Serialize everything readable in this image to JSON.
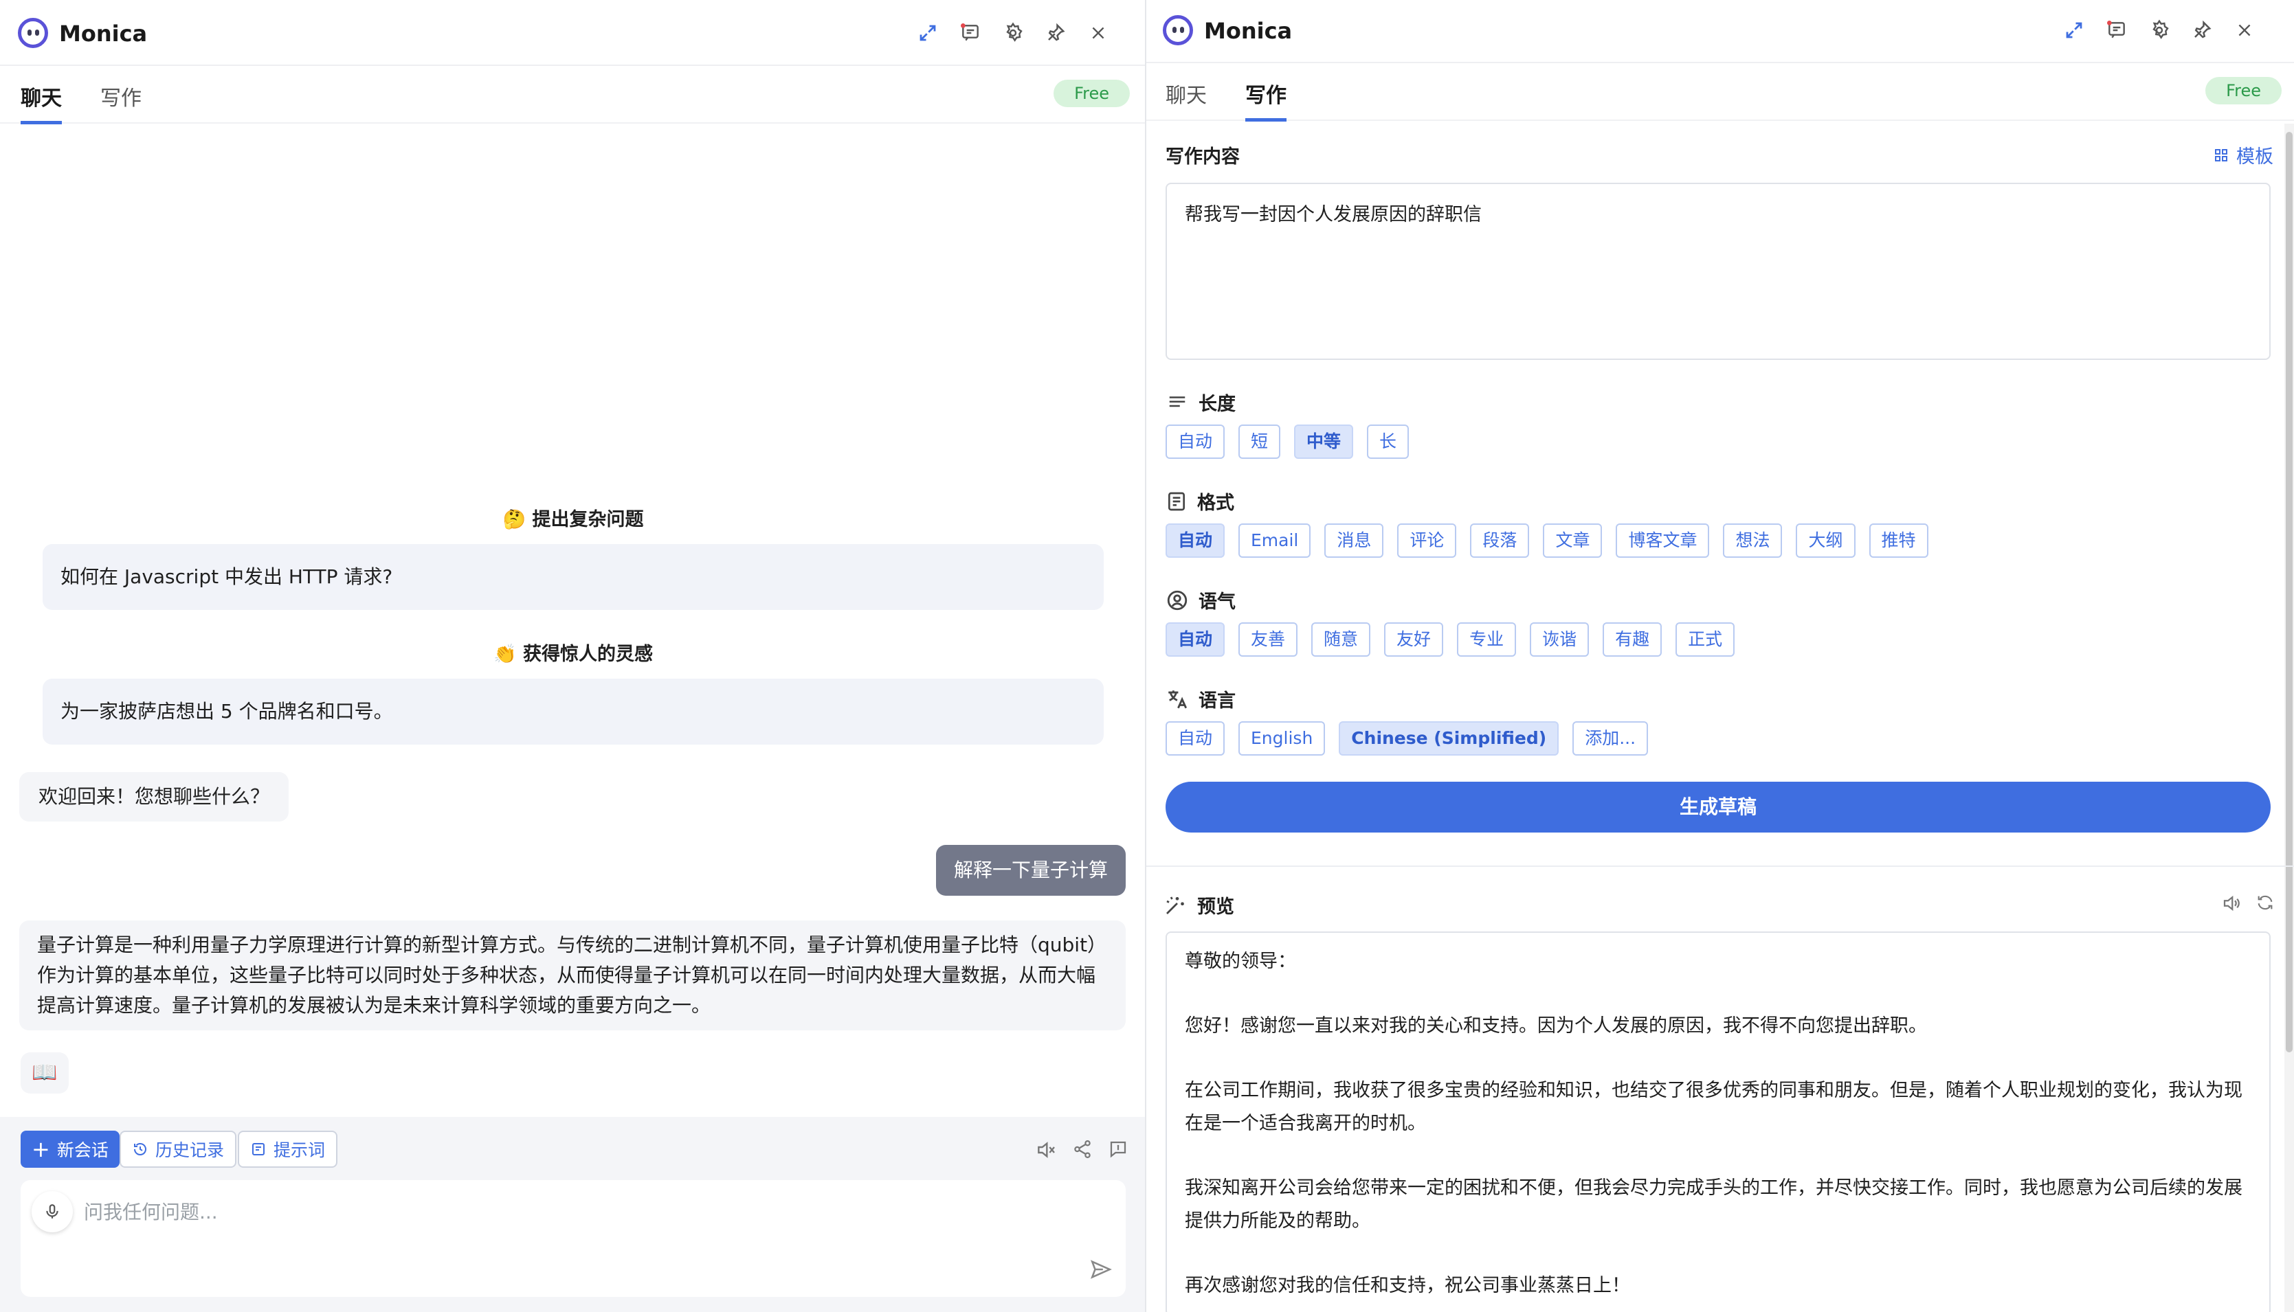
{
  "app": {
    "title": "Monica"
  },
  "left": {
    "tabs": {
      "chat": "聊天",
      "write": "写作"
    },
    "badge": "Free",
    "prompts": [
      {
        "emoji": "🤔",
        "title": "提出复杂问题",
        "example": "如何在 Javascript 中发出 HTTP 请求?"
      },
      {
        "emoji": "👏",
        "title": "获得惊人的灵感",
        "example": "为一家披萨店想出 5 个品牌名和口号。"
      }
    ],
    "messages": {
      "welcome": "欢迎回来！您想聊些什么？",
      "user": "解释一下量子计算",
      "answer": "量子计算是一种利用量子力学原理进行计算的新型计算方式。与传统的二进制计算机不同，量子计算机使用量子比特（qubit）作为计算的基本单位，这些量子比特可以同时处于多种状态，从而使得量子计算机可以在同一时间内处理大量数据，从而大幅提高计算速度。量子计算机的发展被认为是未来计算科学领域的重要方向之一。",
      "book_emoji": "📖"
    },
    "toolbar": {
      "new_chat": "新会话",
      "history": "历史记录",
      "prompts": "提示词"
    },
    "input": {
      "placeholder": "问我任何问题..."
    }
  },
  "right": {
    "tabs": {
      "chat": "聊天",
      "write": "写作"
    },
    "badge": "Free",
    "content_label": "写作内容",
    "template_label": "模板",
    "content_value": "帮我写一封因个人发展原因的辞职信",
    "length": {
      "label": "长度",
      "options": [
        "自动",
        "短",
        "中等",
        "长"
      ],
      "selected": "中等"
    },
    "format": {
      "label": "格式",
      "options": [
        "自动",
        "Email",
        "消息",
        "评论",
        "段落",
        "文章",
        "博客文章",
        "想法",
        "大纲",
        "推特"
      ],
      "selected": "自动"
    },
    "tone": {
      "label": "语气",
      "options": [
        "自动",
        "友善",
        "随意",
        "友好",
        "专业",
        "诙谐",
        "有趣",
        "正式"
      ],
      "selected": "自动"
    },
    "language": {
      "label": "语言",
      "options": [
        "自动",
        "English",
        "Chinese (Simplified)",
        "添加..."
      ],
      "selected": "Chinese (Simplified)"
    },
    "generate_label": "生成草稿",
    "preview_label": "预览",
    "preview_paragraphs": [
      "尊敬的领导：",
      "您好！感谢您一直以来对我的关心和支持。因为个人发展的原因，我不得不向您提出辞职。",
      "在公司工作期间，我收获了很多宝贵的经验和知识，也结交了很多优秀的同事和朋友。但是，随着个人职业规划的变化，我认为现在是一个适合我离开的时机。",
      "我深知离开公司会给您带来一定的困扰和不便，但我会尽力完成手头的工作，并尽快交接工作。同时，我也愿意为公司后续的发展提供力所能及的帮助。",
      "再次感谢您对我的信任和支持，祝公司事业蒸蒸日上！"
    ]
  },
  "colors": {
    "accent": "#3f6ee0",
    "user_bubble": "#73788a",
    "free_bg": "#d8f3dc",
    "free_text": "#2b9a4a"
  }
}
